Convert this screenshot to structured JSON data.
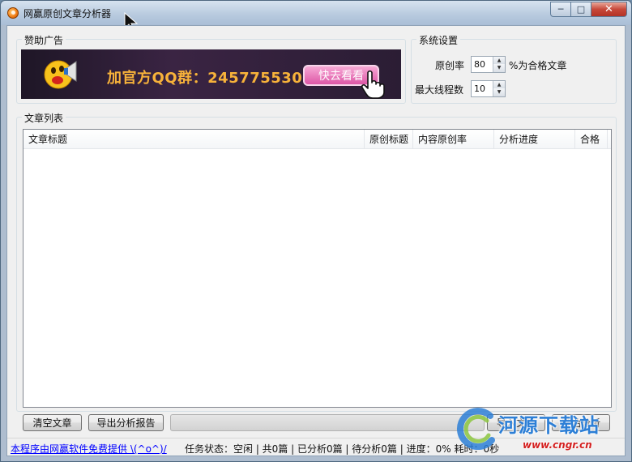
{
  "window": {
    "title": "网赢原创文章分析器",
    "controls": {
      "minimize": "─",
      "maximize": "□",
      "close": "✕"
    }
  },
  "ad": {
    "group_label": "赞助广告",
    "text": "加官方QQ群：245775530",
    "button_label": "快去看看"
  },
  "settings": {
    "group_label": "系统设置",
    "originality_label": "原创率",
    "originality_value": "80",
    "originality_suffix": "%为合格文章",
    "threads_label": "最大线程数",
    "threads_value": "10"
  },
  "articles": {
    "group_label": "文章列表",
    "columns": [
      "文章标题",
      "原创标题",
      "内容原创率",
      "分析进度",
      "合格"
    ],
    "rows": []
  },
  "buttons": {
    "clear": "清空文章",
    "export": "导出分析报告",
    "import": "导入文章",
    "start": "开始分析"
  },
  "status": {
    "link": "本程序由网赢软件免费提供 \\(^o^)/",
    "text": "任务状态：空闲 | 共0篇 | 已分析0篇 | 待分析0篇 | 进度：0%  耗时：0秒"
  },
  "watermark": {
    "title": "河源下载站",
    "url": "www.cngr.cn"
  },
  "colors": {
    "ad_text": "#f7b23a",
    "ad_button": "#dd56a6",
    "link": "#0000ff",
    "watermark_title": "#2d7fd6",
    "watermark_url": "#d41f1f"
  }
}
